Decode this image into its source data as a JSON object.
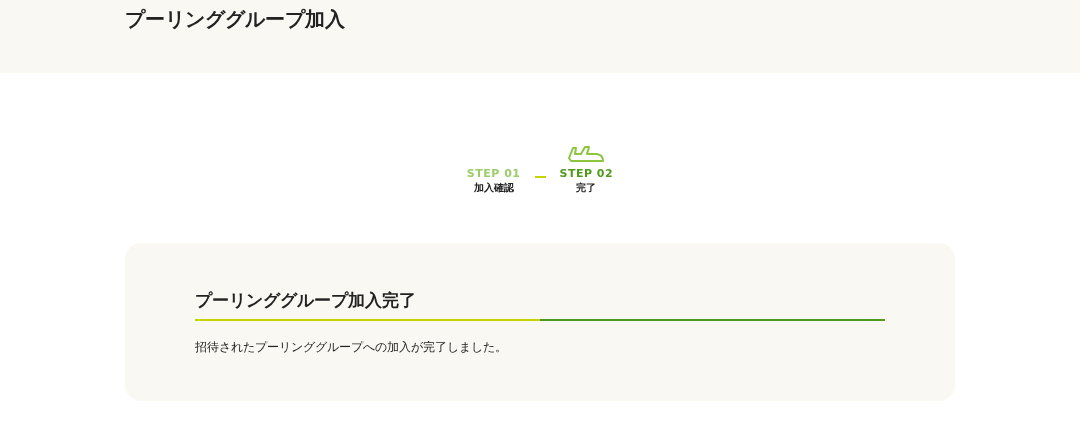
{
  "header": {
    "title": "プーリンググループ加入"
  },
  "steps": [
    {
      "label": "STEP 01",
      "name": "加入確認",
      "selected": false
    },
    {
      "label": "STEP 02",
      "name": "完了",
      "selected": true
    }
  ],
  "card": {
    "title": "プーリンググループ加入完了",
    "message": "招待されたプーリンググループへの加入が完了しました。"
  }
}
